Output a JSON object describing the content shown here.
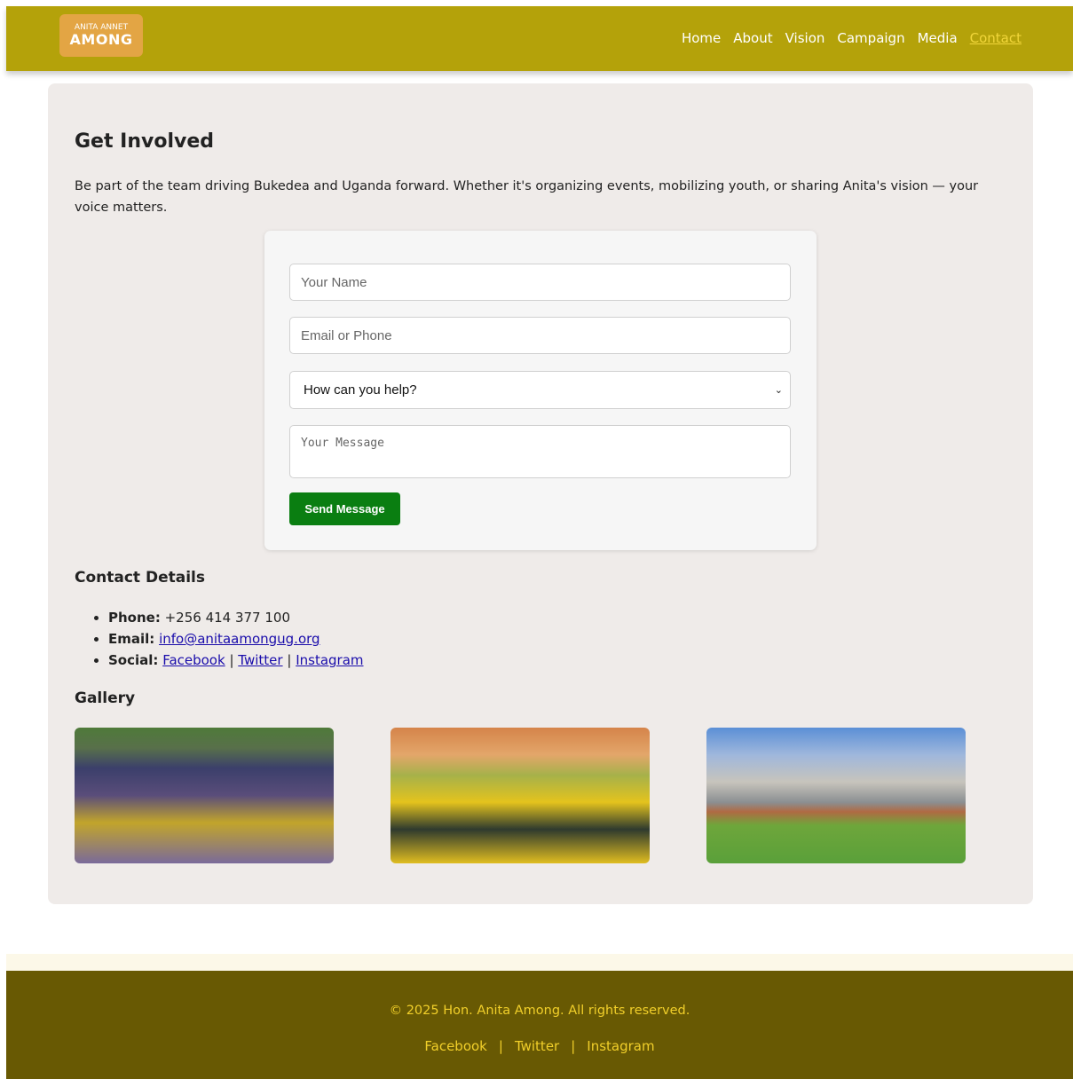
{
  "header": {
    "logo_small": "ANITA ANNET",
    "logo_big": "AMONG",
    "nav": [
      {
        "label": "Home"
      },
      {
        "label": "About"
      },
      {
        "label": "Vision"
      },
      {
        "label": "Campaign"
      },
      {
        "label": "Media"
      },
      {
        "label": "Contact",
        "active": true
      }
    ]
  },
  "main": {
    "title": "Get Involved",
    "intro": "Be part of the team driving Bukedea and Uganda forward. Whether it's organizing events, mobilizing youth, or sharing Anita's vision — your voice matters."
  },
  "form": {
    "name_placeholder": "Your Name",
    "contact_placeholder": "Email or Phone",
    "help_selected": "How can you help?",
    "message_placeholder": "Your Message",
    "submit_label": "Send Message"
  },
  "contact": {
    "heading": "Contact Details",
    "phone_label": "Phone:",
    "phone_value": "+256 414 377 100",
    "email_label": "Email:",
    "email_value": "info@anitaamongug.org",
    "social_label": "Social:",
    "social_links": [
      "Facebook",
      "Twitter",
      "Instagram"
    ],
    "separator": "|"
  },
  "gallery": {
    "heading": "Gallery"
  },
  "footer": {
    "copyright": "© 2025 Hon. Anita Among. All rights reserved.",
    "links": [
      "Facebook",
      "Twitter",
      "Instagram"
    ],
    "separator": "|"
  },
  "colors": {
    "header_bg": "#b4a20a",
    "nav_active": "#f1d63a",
    "button_green": "#0a7e11",
    "footer_bg": "#685903",
    "footer_text": "#f1cf2a"
  }
}
